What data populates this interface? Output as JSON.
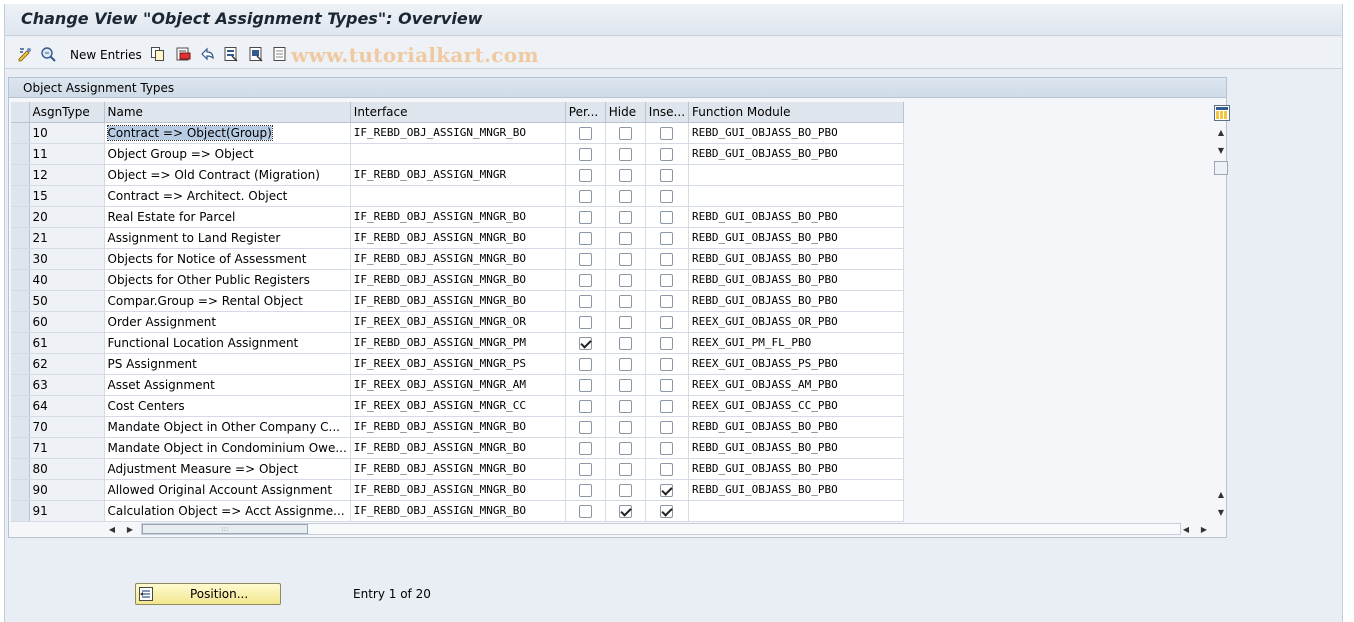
{
  "window": {
    "title": "Change View \"Object Assignment Types\": Overview"
  },
  "toolbar": {
    "new_entries_label": "New Entries",
    "watermark": "www.tutorialkart.com",
    "icons": [
      "display-change-icon",
      "other-view-icon",
      "copy-icon",
      "delete-icon",
      "undo-icon",
      "select-all-icon",
      "select-block-icon",
      "deselect-all-icon"
    ]
  },
  "panel": {
    "title": "Object Assignment Types"
  },
  "table": {
    "columns": [
      "AsgnType",
      "Name",
      "Interface",
      "Per...",
      "Hide",
      "Inse...",
      "Function Module"
    ],
    "rows": [
      {
        "asgn": "10",
        "name": "Contract => Object(Group)",
        "iface": "IF_REBD_OBJ_ASSIGN_MNGR_BO",
        "per": false,
        "hide": false,
        "ins": false,
        "fm": "REBD_GUI_OBJASS_BO_PBO"
      },
      {
        "asgn": "11",
        "name": "Object Group => Object",
        "iface": "",
        "per": false,
        "hide": false,
        "ins": false,
        "fm": "REBD_GUI_OBJASS_BO_PBO"
      },
      {
        "asgn": "12",
        "name": "Object => Old Contract (Migration)",
        "iface": "IF_REBD_OBJ_ASSIGN_MNGR",
        "per": false,
        "hide": false,
        "ins": false,
        "fm": ""
      },
      {
        "asgn": "15",
        "name": "Contract => Architect. Object",
        "iface": "",
        "per": false,
        "hide": false,
        "ins": false,
        "fm": ""
      },
      {
        "asgn": "20",
        "name": "Real Estate for Parcel",
        "iface": "IF_REBD_OBJ_ASSIGN_MNGR_BO",
        "per": false,
        "hide": false,
        "ins": false,
        "fm": "REBD_GUI_OBJASS_BO_PBO"
      },
      {
        "asgn": "21",
        "name": "Assignment to Land Register",
        "iface": "IF_REBD_OBJ_ASSIGN_MNGR_BO",
        "per": false,
        "hide": false,
        "ins": false,
        "fm": "REBD_GUI_OBJASS_BO_PBO"
      },
      {
        "asgn": "30",
        "name": "Objects for Notice of Assessment",
        "iface": "IF_REBD_OBJ_ASSIGN_MNGR_BO",
        "per": false,
        "hide": false,
        "ins": false,
        "fm": "REBD_GUI_OBJASS_BO_PBO"
      },
      {
        "asgn": "40",
        "name": "Objects for Other Public Registers",
        "iface": "IF_REBD_OBJ_ASSIGN_MNGR_BO",
        "per": false,
        "hide": false,
        "ins": false,
        "fm": "REBD_GUI_OBJASS_BO_PBO"
      },
      {
        "asgn": "50",
        "name": "Compar.Group => Rental Object",
        "iface": "IF_REBD_OBJ_ASSIGN_MNGR_BO",
        "per": false,
        "hide": false,
        "ins": false,
        "fm": "REBD_GUI_OBJASS_BO_PBO"
      },
      {
        "asgn": "60",
        "name": "Order Assignment",
        "iface": "IF_REEX_OBJ_ASSIGN_MNGR_OR",
        "per": false,
        "hide": false,
        "ins": false,
        "fm": "REEX_GUI_OBJASS_OR_PBO"
      },
      {
        "asgn": "61",
        "name": "Functional Location Assignment",
        "iface": "IF_REBD_OBJ_ASSIGN_MNGR_PM",
        "per": true,
        "hide": false,
        "ins": false,
        "fm": "REEX_GUI_PM_FL_PBO"
      },
      {
        "asgn": "62",
        "name": "PS Assignment",
        "iface": "IF_REEX_OBJ_ASSIGN_MNGR_PS",
        "per": false,
        "hide": false,
        "ins": false,
        "fm": "REEX_GUI_OBJASS_PS_PBO"
      },
      {
        "asgn": "63",
        "name": "Asset Assignment",
        "iface": "IF_REEX_OBJ_ASSIGN_MNGR_AM",
        "per": false,
        "hide": false,
        "ins": false,
        "fm": "REEX_GUI_OBJASS_AM_PBO"
      },
      {
        "asgn": "64",
        "name": "Cost Centers",
        "iface": "IF_REEX_OBJ_ASSIGN_MNGR_CC",
        "per": false,
        "hide": false,
        "ins": false,
        "fm": "REEX_GUI_OBJASS_CC_PBO"
      },
      {
        "asgn": "70",
        "name": "Mandate Object in Other Company C...",
        "iface": "IF_REBD_OBJ_ASSIGN_MNGR_BO",
        "per": false,
        "hide": false,
        "ins": false,
        "fm": "REBD_GUI_OBJASS_BO_PBO"
      },
      {
        "asgn": "71",
        "name": "Mandate Object in Condominium Owe...",
        "iface": "IF_REBD_OBJ_ASSIGN_MNGR_BO",
        "per": false,
        "hide": false,
        "ins": false,
        "fm": "REBD_GUI_OBJASS_BO_PBO"
      },
      {
        "asgn": "80",
        "name": "Adjustment Measure => Object",
        "iface": "IF_REBD_OBJ_ASSIGN_MNGR_BO",
        "per": false,
        "hide": false,
        "ins": false,
        "fm": "REBD_GUI_OBJASS_BO_PBO"
      },
      {
        "asgn": "90",
        "name": "Allowed Original Account Assignment",
        "iface": "IF_REBD_OBJ_ASSIGN_MNGR_BO",
        "per": false,
        "hide": false,
        "ins": true,
        "fm": "REBD_GUI_OBJASS_BO_PBO"
      },
      {
        "asgn": "91",
        "name": "Calculation Object => Acct Assignme...",
        "iface": "IF_REBD_OBJ_ASSIGN_MNGR_BO",
        "per": false,
        "hide": true,
        "ins": true,
        "fm": ""
      }
    ]
  },
  "footer": {
    "position_button_label": "Position...",
    "entry_info": "Entry 1 of 20"
  }
}
